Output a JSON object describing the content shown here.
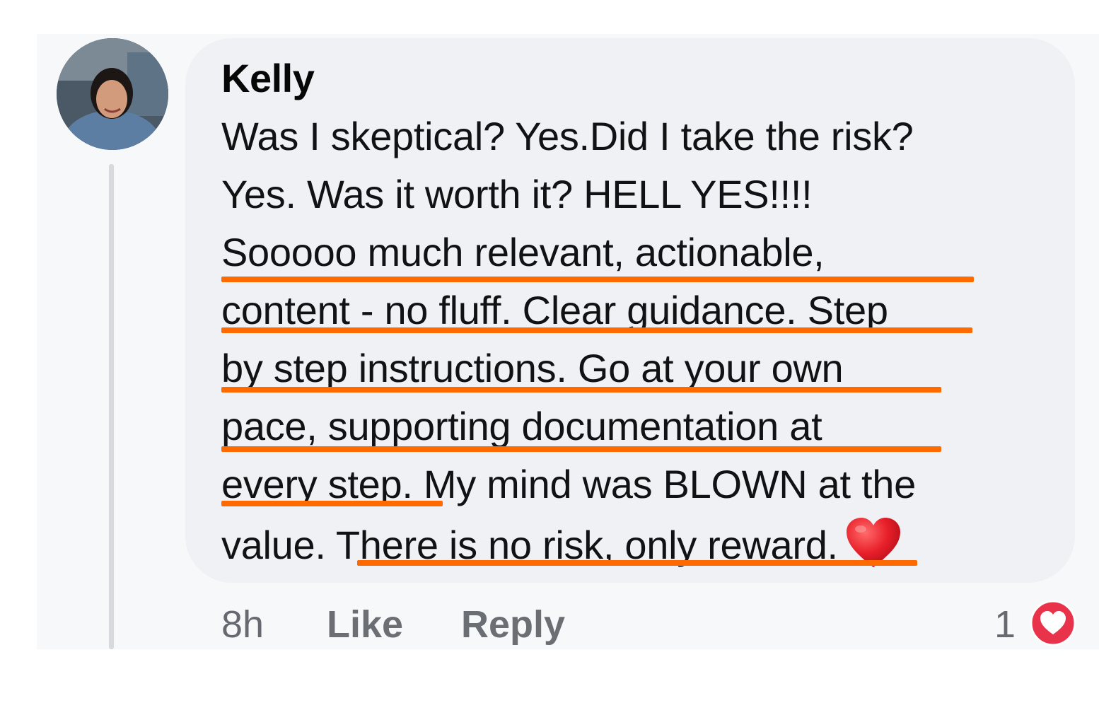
{
  "comment": {
    "author": "Kelly",
    "lines": [
      "Was I skeptical? Yes.Did I take the risk?",
      "Yes. Was it worth it? HELL YES!!!!",
      "Sooooo much relevant, actionable,",
      "content - no fluff. Clear guidance. Step",
      "by step instructions. Go at your own",
      "pace, supporting documentation at",
      "every step. My mind was BLOWN at the",
      "value. There is no risk, only reward."
    ],
    "emoji_icon": "red-heart-emoji",
    "highlight_color": "#ff6a00"
  },
  "footer": {
    "time": "8h",
    "like_label": "Like",
    "reply_label": "Reply",
    "reaction_count": "1",
    "reaction_icon": "love-reaction-icon",
    "reaction_color": "#e8334a"
  }
}
